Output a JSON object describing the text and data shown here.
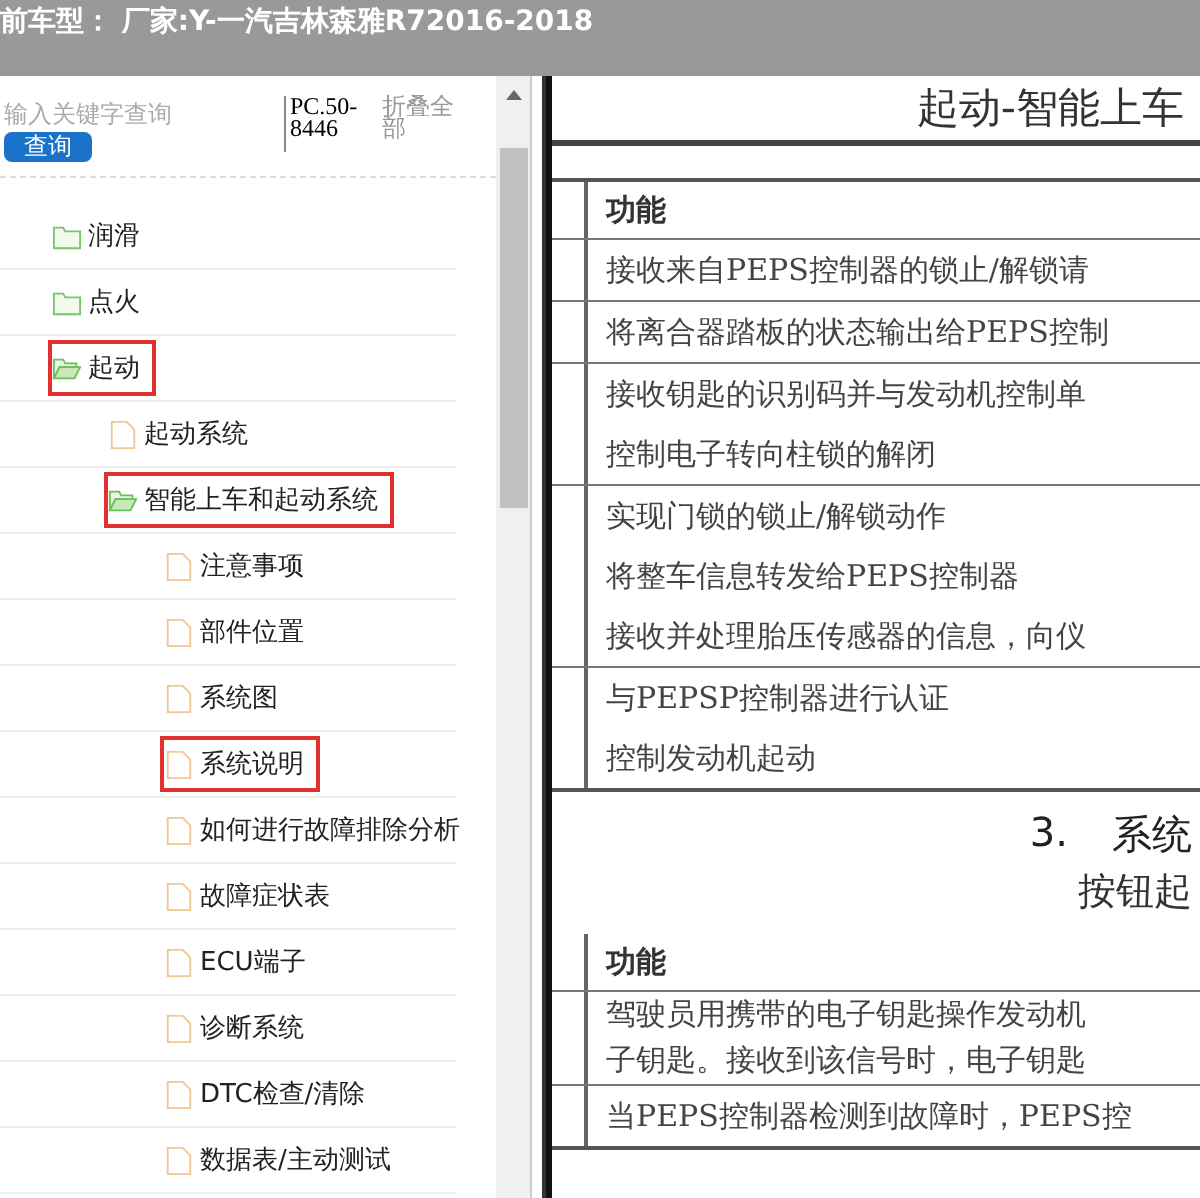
{
  "header": {
    "title": "前车型： 厂家:Y-一汽吉林森雅R72016-2018"
  },
  "sidebar": {
    "search": {
      "placeholder": "输入关键字查询"
    },
    "search_button": "查询",
    "code": "PC.50-8446",
    "collapse_all": "折叠全部",
    "tree": [
      {
        "label": "润滑",
        "kind": "folder",
        "expanded": false,
        "highlighted": false
      },
      {
        "label": "点火",
        "kind": "folder",
        "expanded": false,
        "highlighted": false
      },
      {
        "label": "起动",
        "kind": "folder",
        "expanded": true,
        "highlighted": true,
        "children": [
          {
            "label": "起动系统",
            "kind": "file",
            "highlighted": false
          },
          {
            "label": "智能上车和起动系统",
            "kind": "folder",
            "expanded": true,
            "highlighted": true,
            "children": [
              {
                "label": "注意事项",
                "kind": "file",
                "highlighted": false
              },
              {
                "label": "部件位置",
                "kind": "file",
                "highlighted": false
              },
              {
                "label": "系统图",
                "kind": "file",
                "highlighted": false
              },
              {
                "label": "系统说明",
                "kind": "file",
                "highlighted": true
              },
              {
                "label": "如何进行故障排除分析",
                "kind": "file",
                "highlighted": false
              },
              {
                "label": "故障症状表",
                "kind": "file",
                "highlighted": false
              },
              {
                "label": "ECU端子",
                "kind": "file",
                "highlighted": false
              },
              {
                "label": "诊断系统",
                "kind": "file",
                "highlighted": false
              },
              {
                "label": "DTC检查/清除",
                "kind": "file",
                "highlighted": false
              },
              {
                "label": "数据表/主动测试",
                "kind": "file",
                "highlighted": false
              }
            ]
          }
        ]
      }
    ]
  },
  "document": {
    "title": "起动-智能上车",
    "tables": [
      {
        "header": "功能",
        "rows": [
          [
            "接收来自PEPS控制器的锁止/解锁请"
          ],
          [
            "将离合器踏板的状态输出给PEPS控制"
          ],
          [
            "接收钥匙的识别码并与发动机控制单",
            "控制电子转向柱锁的解闭"
          ],
          [
            "实现门锁的锁止/解锁动作",
            "将整车信息转发给PEPS控制器",
            "接收并处理胎压传感器的信息，向仪"
          ],
          [
            "与PEPSP控制器进行认证",
            "控制发动机起动"
          ]
        ]
      },
      {
        "section_number": "3.",
        "section_title": "系统",
        "subtitle": "按钮起",
        "header": "功能",
        "rows": [
          [
            "驾驶员用携带的电子钥匙操作发动机",
            "子钥匙。接收到该信号时，电子钥匙"
          ],
          [
            "当PEPS控制器检测到故障时，PEPS控"
          ]
        ]
      }
    ]
  }
}
